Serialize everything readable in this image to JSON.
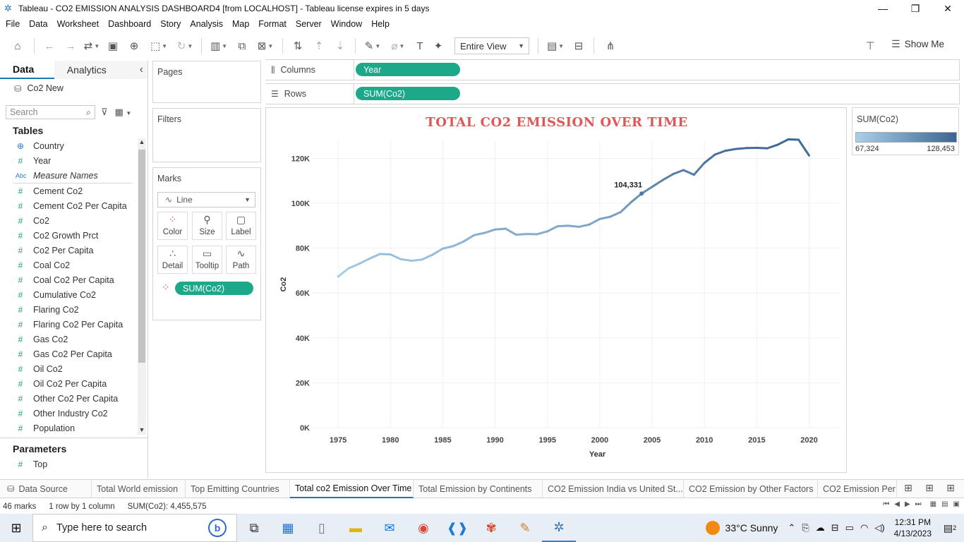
{
  "window": {
    "title": "Tableau - CO2 EMISSION ANALYSIS DASHBOARD4 [from LOCALHOST] - Tableau license expires in 5 days",
    "minimize": "—",
    "restore": "❐",
    "close": "✕"
  },
  "menu": [
    "File",
    "Data",
    "Worksheet",
    "Dashboard",
    "Story",
    "Analysis",
    "Map",
    "Format",
    "Server",
    "Window",
    "Help"
  ],
  "toolbar": {
    "view_mode": "Entire View",
    "show_me": "Show Me"
  },
  "left_panel": {
    "tab_data": "Data",
    "tab_analytics": "Analytics",
    "collapse": "‹",
    "datasource": "Co2 New",
    "search_placeholder": "Search",
    "tables_heading": "Tables",
    "fields": [
      {
        "label": "Country",
        "type": "geo"
      },
      {
        "label": "Year",
        "type": "measure"
      },
      {
        "label": "Measure Names",
        "type": "abc"
      },
      {
        "label": "Cement Co2",
        "type": "measure"
      },
      {
        "label": "Cement Co2 Per Capita",
        "type": "measure"
      },
      {
        "label": "Co2",
        "type": "measure"
      },
      {
        "label": "Co2 Growth Prct",
        "type": "measure"
      },
      {
        "label": "Co2 Per Capita",
        "type": "measure"
      },
      {
        "label": "Coal Co2",
        "type": "measure"
      },
      {
        "label": "Coal Co2 Per Capita",
        "type": "measure"
      },
      {
        "label": "Cumulative Co2",
        "type": "measure"
      },
      {
        "label": "Flaring Co2",
        "type": "measure"
      },
      {
        "label": "Flaring Co2 Per Capita",
        "type": "measure"
      },
      {
        "label": "Gas Co2",
        "type": "measure"
      },
      {
        "label": "Gas Co2 Per Capita",
        "type": "measure"
      },
      {
        "label": "Oil Co2",
        "type": "measure"
      },
      {
        "label": "Oil Co2 Per Capita",
        "type": "measure"
      },
      {
        "label": "Other Co2 Per Capita",
        "type": "measure"
      },
      {
        "label": "Other Industry Co2",
        "type": "measure"
      },
      {
        "label": "Population",
        "type": "measure"
      }
    ],
    "parameters_heading": "Parameters",
    "parameters": [
      {
        "label": "Top",
        "type": "measure"
      }
    ]
  },
  "shelves": {
    "pages": "Pages",
    "filters": "Filters",
    "marks": "Marks",
    "mark_type": "Line",
    "mark_buttons": [
      "Color",
      "Size",
      "Label",
      "Detail",
      "Tooltip",
      "Path"
    ],
    "marks_pill": "SUM(Co2)",
    "columns_label": "Columns",
    "columns_pill": "Year",
    "rows_label": "Rows",
    "rows_pill": "SUM(Co2)"
  },
  "legend": {
    "title": "SUM(Co2)",
    "min": "67,324",
    "max": "128,453",
    "color_low": "#a9cfe8",
    "color_high": "#3b6592"
  },
  "chart_data": {
    "type": "line",
    "title": "TOTAL CO2 EMISSION OVER TIME",
    "xlabel": "Year",
    "ylabel": "Co2",
    "x_ticks": [
      1975,
      1980,
      1985,
      1990,
      1995,
      2000,
      2005,
      2010,
      2015,
      2020
    ],
    "y_ticks": [
      0,
      20000,
      40000,
      60000,
      80000,
      100000,
      120000
    ],
    "y_tick_labels": [
      "0K",
      "20K",
      "40K",
      "60K",
      "80K",
      "100K",
      "120K"
    ],
    "xlim": [
      1972.5,
      2023
    ],
    "ylim": [
      0,
      128000
    ],
    "grid": true,
    "annotation": {
      "x": 2004,
      "y": 104331,
      "label": "104,331"
    },
    "series": [
      {
        "x": [
          1975,
          1976,
          1977,
          1978,
          1979,
          1980,
          1981,
          1982,
          1983,
          1984,
          1985,
          1986,
          1987,
          1988,
          1989,
          1990,
          1991,
          1992,
          1993,
          1994,
          1995,
          1996,
          1997,
          1998,
          1999,
          2000,
          2001,
          2002,
          2003,
          2004,
          2005,
          2006,
          2007,
          2008,
          2009,
          2010,
          2011,
          2012,
          2013,
          2014,
          2015,
          2016,
          2017,
          2018,
          2019,
          2020
        ],
        "values": [
          67324,
          71000,
          73000,
          75300,
          77400,
          77200,
          75100,
          74400,
          74900,
          77000,
          79800,
          80900,
          83000,
          85800,
          86800,
          88300,
          88700,
          86000,
          86300,
          86200,
          87500,
          89800,
          90000,
          89500,
          90500,
          93000,
          94000,
          96100,
          100500,
          104331,
          107300,
          110300,
          113000,
          114800,
          112700,
          118000,
          121700,
          123400,
          124200,
          124600,
          124700,
          124500,
          126100,
          128453,
          128300,
          121300
        ]
      }
    ]
  },
  "sheets": {
    "datasource": "Data Source",
    "tabs": [
      "Total World emission",
      "Top Emitting Countries",
      "Total co2 Emission Over Time",
      "Total Emission by Continents",
      "CO2 Emission India vs United St...",
      "CO2 Emission by Other Factors",
      "CO2 Emission Per"
    ],
    "active_index": 2
  },
  "status": {
    "marks": "46 marks",
    "rows": "1 row by 1 column",
    "sum": "SUM(Co2): 4,455,575"
  },
  "taskbar": {
    "search_placeholder": "Type here to search",
    "weather": "33°C  Sunny",
    "time": "12:31 PM",
    "date": "4/13/2023",
    "notifications": "2"
  }
}
